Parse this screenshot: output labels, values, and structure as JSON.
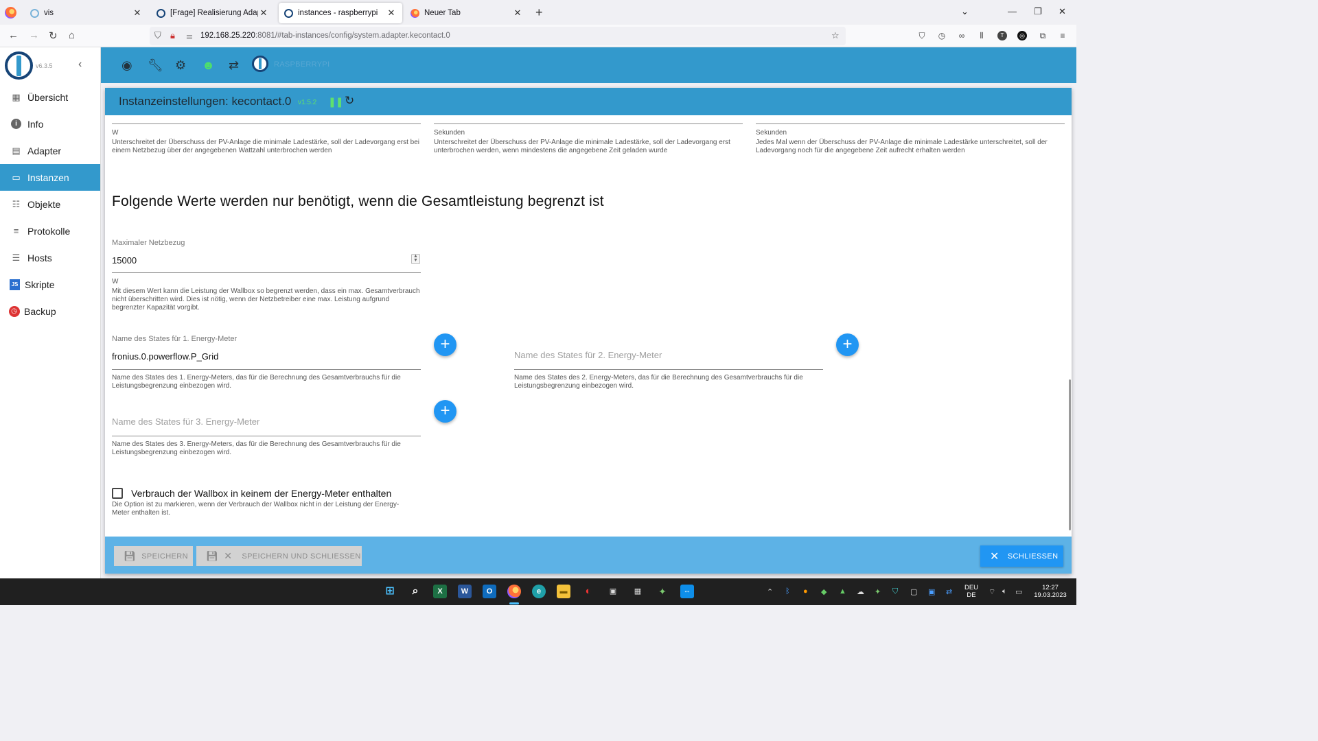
{
  "browser": {
    "tabs": [
      {
        "title": "vis",
        "active": false
      },
      {
        "title": "[Frage] Realisierung Adapter UD",
        "active": false
      },
      {
        "title": "instances - raspberrypi",
        "active": true
      },
      {
        "title": "Neuer Tab",
        "active": false
      }
    ],
    "url_host": "192.168.25.220",
    "url_rest": ":8081/#tab-instances/config/system.adapter.kecontact.0"
  },
  "app": {
    "version": "v6.3.5",
    "host_name": "RASPBERRYPI",
    "sidebar": [
      {
        "label": "Übersicht",
        "icon": "grid-icon",
        "active": false
      },
      {
        "label": "Info",
        "icon": "info-icon",
        "active": false
      },
      {
        "label": "Adapter",
        "icon": "store-icon",
        "active": false
      },
      {
        "label": "Instanzen",
        "icon": "instances-icon",
        "active": true
      },
      {
        "label": "Objekte",
        "icon": "list-icon",
        "active": false
      },
      {
        "label": "Protokolle",
        "icon": "log-icon",
        "active": false
      },
      {
        "label": "Hosts",
        "icon": "hosts-icon",
        "active": false
      },
      {
        "label": "Skripte",
        "icon": "js-icon",
        "active": false
      },
      {
        "label": "Backup",
        "icon": "backup-icon",
        "active": false
      }
    ]
  },
  "dialog": {
    "title": "Instanzeinstellungen: kecontact.0",
    "version": "v1.5.2",
    "top_fields": [
      {
        "unit": "W",
        "help": "Unterschreitet der Überschuss der PV-Anlage die minimale Ladestärke, soll der Ladevorgang erst bei einem Netzbezug über der angegebenen Wattzahl unterbrochen werden"
      },
      {
        "unit": "Sekunden",
        "help": "Unterschreitet der Überschuss der PV-Anlage die minimale Ladestärke, soll der Ladevorgang erst unterbrochen werden, wenn mindestens die angegebene Zeit geladen wurde"
      },
      {
        "unit": "Sekunden",
        "help": "Jedes Mal wenn der Überschuss der PV-Anlage die minimale Ladestärke unterschreitet, soll der Ladevorgang noch für die angegebene Zeit aufrecht erhalten werden"
      }
    ],
    "section_title": "Folgende Werte werden nur benötigt, wenn die Gesamtleistung begrenzt ist",
    "max_grid": {
      "label": "Maximaler Netzbezug",
      "value": "15000",
      "unit": "W",
      "help": "Mit diesem Wert kann die Leistung der Wallbox so begrenzt werden, dass ein max. Gesamtverbrauch nicht überschritten wird. Dies ist nötig, wenn der Netzbetreiber eine max. Leistung aufgrund begrenzter Kapazität vorgibt."
    },
    "energy_meter_1": {
      "label": "Name des States für 1. Energy-Meter",
      "value": "fronius.0.powerflow.P_Grid",
      "help": "Name des States des 1. Energy-Meters, das für die Berechnung des Gesamtverbrauchs für die Leistungsbegrenzung einbezogen wird."
    },
    "energy_meter_2": {
      "placeholder": "Name des States für 2. Energy-Meter",
      "help": "Name des States des 2. Energy-Meters, das für die Berechnung des Gesamtverbrauchs für die Leistungsbegrenzung einbezogen wird."
    },
    "energy_meter_3": {
      "placeholder": "Name des States für 3. Energy-Meter",
      "help": "Name des States des 3. Energy-Meters, das für die Berechnung des Gesamtverbrauchs für die Leistungsbegrenzung einbezogen wird."
    },
    "wallbox_option": {
      "label": "Verbrauch der Wallbox in keinem der Energy-Meter enthalten",
      "help": "Die Option ist zu markieren, wenn der Verbrauch der Wallbox nicht in der Leistung der Energy-Meter enthalten ist.",
      "checked": false
    },
    "buttons": {
      "save": "SPEICHERN",
      "save_close": "SPEICHERN UND SCHLIESSEN",
      "close": "SCHLIESSEN"
    }
  },
  "taskbar": {
    "lang_top": "DEU",
    "lang_bottom": "DE",
    "time": "12:27",
    "date": "19.03.2023"
  },
  "colors": {
    "accent": "#3399cc",
    "primary_button": "#2196f3",
    "footer": "#5db2e6",
    "version_green": "#5fe06e"
  }
}
